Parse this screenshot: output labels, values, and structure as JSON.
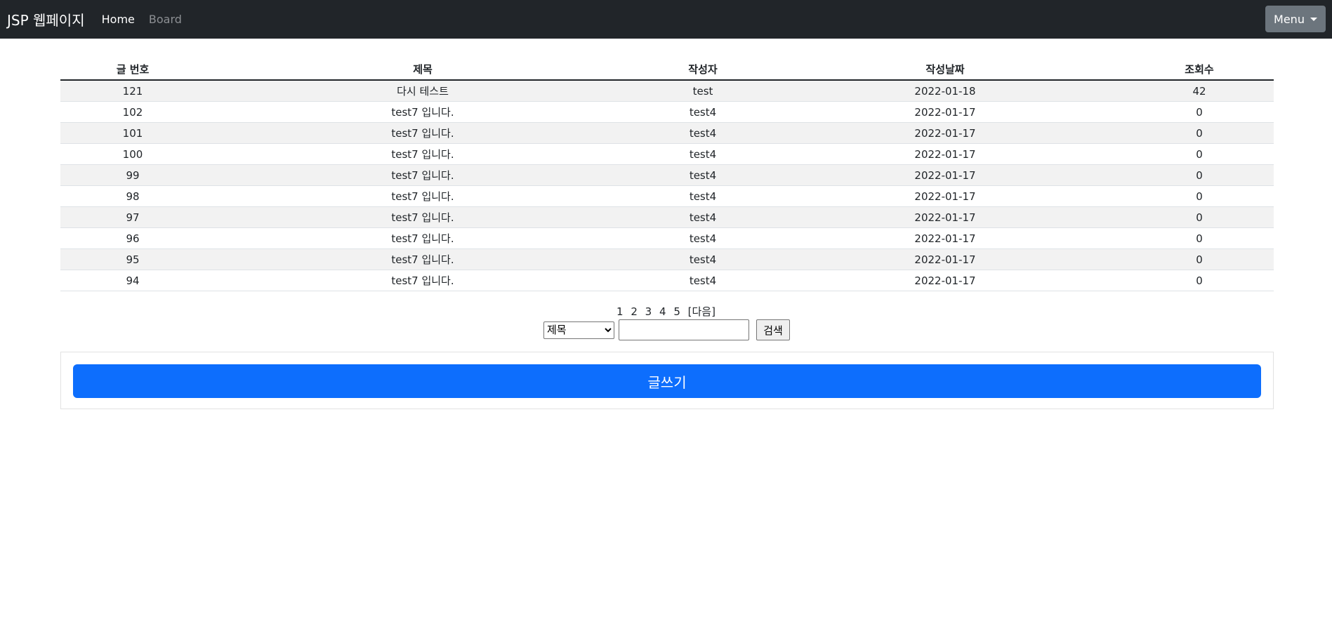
{
  "navbar": {
    "brand": "JSP 웹페이지",
    "links": [
      "Home",
      "Board"
    ],
    "menu_label": "Menu"
  },
  "board": {
    "headers": [
      "글 번호",
      "제목",
      "작성자",
      "작성날짜",
      "조회수"
    ],
    "rows": [
      {
        "no": "121",
        "title": "다시 테스트",
        "writer": "test",
        "date": "2022-01-18",
        "views": "42"
      },
      {
        "no": "102",
        "title": "test7 입니다.",
        "writer": "test4",
        "date": "2022-01-17",
        "views": "0"
      },
      {
        "no": "101",
        "title": "test7 입니다.",
        "writer": "test4",
        "date": "2022-01-17",
        "views": "0"
      },
      {
        "no": "100",
        "title": "test7 입니다.",
        "writer": "test4",
        "date": "2022-01-17",
        "views": "0"
      },
      {
        "no": "99",
        "title": "test7 입니다.",
        "writer": "test4",
        "date": "2022-01-17",
        "views": "0"
      },
      {
        "no": "98",
        "title": "test7 입니다.",
        "writer": "test4",
        "date": "2022-01-17",
        "views": "0"
      },
      {
        "no": "97",
        "title": "test7 입니다.",
        "writer": "test4",
        "date": "2022-01-17",
        "views": "0"
      },
      {
        "no": "96",
        "title": "test7 입니다.",
        "writer": "test4",
        "date": "2022-01-17",
        "views": "0"
      },
      {
        "no": "95",
        "title": "test7 입니다.",
        "writer": "test4",
        "date": "2022-01-17",
        "views": "0"
      },
      {
        "no": "94",
        "title": "test7 입니다.",
        "writer": "test4",
        "date": "2022-01-17",
        "views": "0"
      }
    ]
  },
  "pagination": {
    "pages": [
      "1",
      "2",
      "3",
      "4",
      "5"
    ],
    "next_label": "[다음]"
  },
  "search": {
    "selected_option": "제목",
    "input_value": "",
    "button_label": "검색"
  },
  "write": {
    "button_label": "글쓰기"
  },
  "colors": {
    "navbar_bg": "#212529",
    "menu_button_bg": "#6c757d",
    "primary": "#0d6efd",
    "stripe": "#f2f2f2"
  }
}
